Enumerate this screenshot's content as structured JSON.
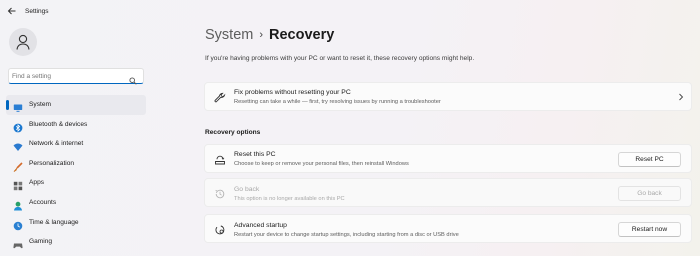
{
  "window": {
    "title": "Settings"
  },
  "search": {
    "placeholder": "Find a setting"
  },
  "sidebar": {
    "items": [
      {
        "label": "System",
        "icon": "system-icon",
        "active": true
      },
      {
        "label": "Bluetooth & devices",
        "icon": "bluetooth-icon"
      },
      {
        "label": "Network & internet",
        "icon": "wifi-icon"
      },
      {
        "label": "Personalization",
        "icon": "brush-icon"
      },
      {
        "label": "Apps",
        "icon": "apps-icon"
      },
      {
        "label": "Accounts",
        "icon": "accounts-icon"
      },
      {
        "label": "Time & language",
        "icon": "globe-clock-icon"
      },
      {
        "label": "Gaming",
        "icon": "gamepad-icon"
      }
    ]
  },
  "breadcrumb": {
    "parent": "System",
    "separator": "›",
    "current": "Recovery"
  },
  "intro": "If you're having problems with your PC or want to reset it, these recovery options might help.",
  "fix": {
    "title": "Fix problems without resetting your PC",
    "desc": "Resetting can take a while — first, try resolving issues by running a troubleshooter"
  },
  "recovery": {
    "section_title": "Recovery options",
    "reset": {
      "title": "Reset this PC",
      "desc": "Choose to keep or remove your personal files, then reinstall Windows",
      "button": "Reset PC"
    },
    "goback": {
      "title": "Go back",
      "desc": "This option is no longer available on this PC",
      "button": "Go back"
    },
    "advanced": {
      "title": "Advanced startup",
      "desc": "Restart your device to change startup settings, including starting from a disc or USB drive",
      "button": "Restart now"
    }
  },
  "colors": {
    "accent": "#0067c0"
  }
}
